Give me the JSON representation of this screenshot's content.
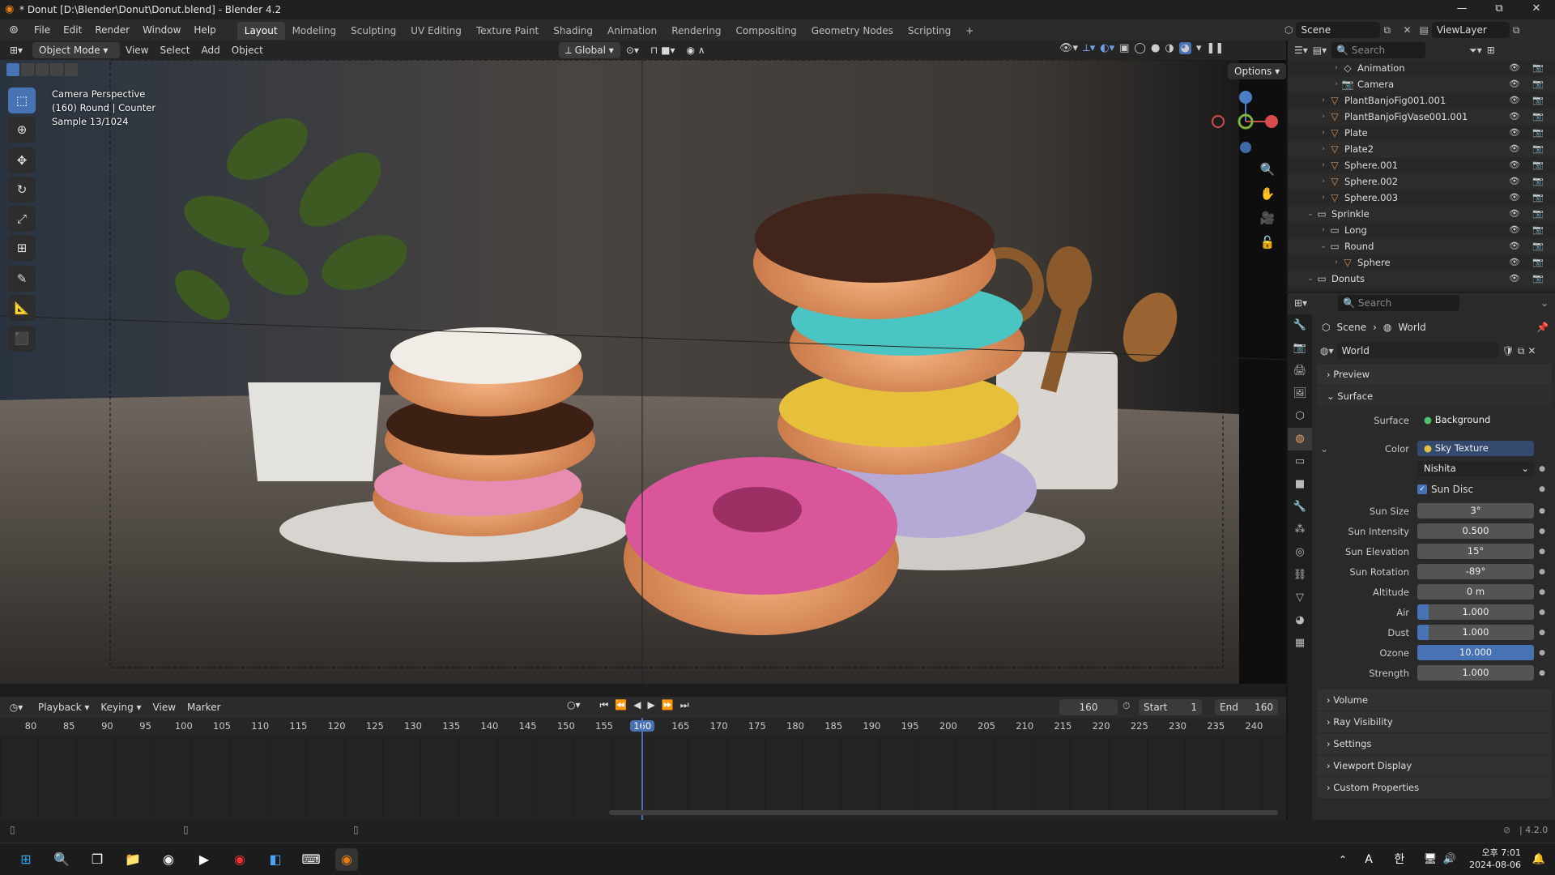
{
  "window": {
    "title": "* Donut [D:\\Blender\\Donut\\Donut.blend] - Blender 4.2",
    "min": "—",
    "max": "⧉",
    "close": "✕"
  },
  "menu": [
    "File",
    "Edit",
    "Render",
    "Window",
    "Help"
  ],
  "workspaces": [
    "Layout",
    "Modeling",
    "Sculpting",
    "UV Editing",
    "Texture Paint",
    "Shading",
    "Animation",
    "Rendering",
    "Compositing",
    "Geometry Nodes",
    "Scripting"
  ],
  "active_workspace": "Layout",
  "scene": {
    "name": "Scene",
    "view_layer": "ViewLayer"
  },
  "viewport": {
    "mode": "Object Mode",
    "menus": [
      "View",
      "Select",
      "Add",
      "Object"
    ],
    "orientation": "Global",
    "options": "Options",
    "info": [
      "Camera Perspective",
      "(160) Round | Counter",
      "Sample 13/1024"
    ]
  },
  "outliner": {
    "search_placeholder": "Search",
    "rows": [
      {
        "label": "Animation",
        "indent": 3,
        "icon": "◇",
        "tri": "›"
      },
      {
        "label": "Camera",
        "indent": 3,
        "icon": "📷",
        "tri": "›"
      },
      {
        "label": "PlantBanjoFig001.001",
        "indent": 2,
        "icon": "▽",
        "tri": "›"
      },
      {
        "label": "PlantBanjoFigVase001.001",
        "indent": 2,
        "icon": "▽",
        "tri": "›"
      },
      {
        "label": "Plate",
        "indent": 2,
        "icon": "▽",
        "tri": "›"
      },
      {
        "label": "Plate2",
        "indent": 2,
        "icon": "▽",
        "tri": "›"
      },
      {
        "label": "Sphere.001",
        "indent": 2,
        "icon": "▽",
        "tri": "›"
      },
      {
        "label": "Sphere.002",
        "indent": 2,
        "icon": "▽",
        "tri": "›"
      },
      {
        "label": "Sphere.003",
        "indent": 2,
        "icon": "▽",
        "tri": "›"
      },
      {
        "label": "Sprinkle",
        "indent": 1,
        "icon": "▭",
        "tri": "⌄"
      },
      {
        "label": "Long",
        "indent": 2,
        "icon": "▭",
        "tri": "›"
      },
      {
        "label": "Round",
        "indent": 2,
        "icon": "▭",
        "tri": "⌄"
      },
      {
        "label": "Sphere",
        "indent": 3,
        "icon": "▽",
        "tri": "›"
      },
      {
        "label": "Donuts",
        "indent": 1,
        "icon": "▭",
        "tri": "⌄"
      }
    ]
  },
  "properties": {
    "search_placeholder": "Search",
    "breadcrumb": [
      "Scene",
      "World"
    ],
    "world_name": "World",
    "panels": {
      "preview": "Preview",
      "surface": "Surface",
      "volume": "Volume",
      "ray_visibility": "Ray Visibility",
      "settings": "Settings",
      "viewport_display": "Viewport Display",
      "custom_properties": "Custom Properties"
    },
    "surface_label": "Surface",
    "surface_value": "Background",
    "color_label": "Color",
    "color_value": "Sky Texture",
    "sky_type": "Nishita",
    "sun_disc": "Sun Disc",
    "fields": [
      {
        "label": "Sun Size",
        "value": "3°",
        "fill": 0
      },
      {
        "label": "Sun Intensity",
        "value": "0.500",
        "fill": 0
      },
      {
        "label": "Sun Elevation",
        "value": "15°",
        "fill": 0
      },
      {
        "label": "Sun Rotation",
        "value": "-89°",
        "fill": 0
      },
      {
        "label": "Altitude",
        "value": "0 m",
        "fill": 0
      },
      {
        "label": "Air",
        "value": "1.000",
        "fill": 0.1
      },
      {
        "label": "Dust",
        "value": "1.000",
        "fill": 0.1
      },
      {
        "label": "Ozone",
        "value": "10.000",
        "fill": 1.0
      },
      {
        "label": "Strength",
        "value": "1.000",
        "fill": 0
      }
    ]
  },
  "timeline": {
    "menus": [
      "Playback",
      "Keying",
      "View",
      "Marker"
    ],
    "current_frame": "160",
    "start_label": "Start",
    "start": "1",
    "end_label": "End",
    "end": "160",
    "ticks": [
      "80",
      "85",
      "90",
      "95",
      "100",
      "105",
      "110",
      "115",
      "120",
      "125",
      "130",
      "135",
      "140",
      "145",
      "150",
      "155",
      "160",
      "165",
      "170",
      "175",
      "180",
      "185",
      "190",
      "195",
      "200",
      "205",
      "210",
      "215",
      "220",
      "225",
      "230",
      "235",
      "240"
    ]
  },
  "status": {
    "version": "4.2.0"
  },
  "taskbar": {
    "time": "오후 7:01",
    "date": "2024-08-06",
    "ime_a": "A",
    "ime_han": "한"
  }
}
